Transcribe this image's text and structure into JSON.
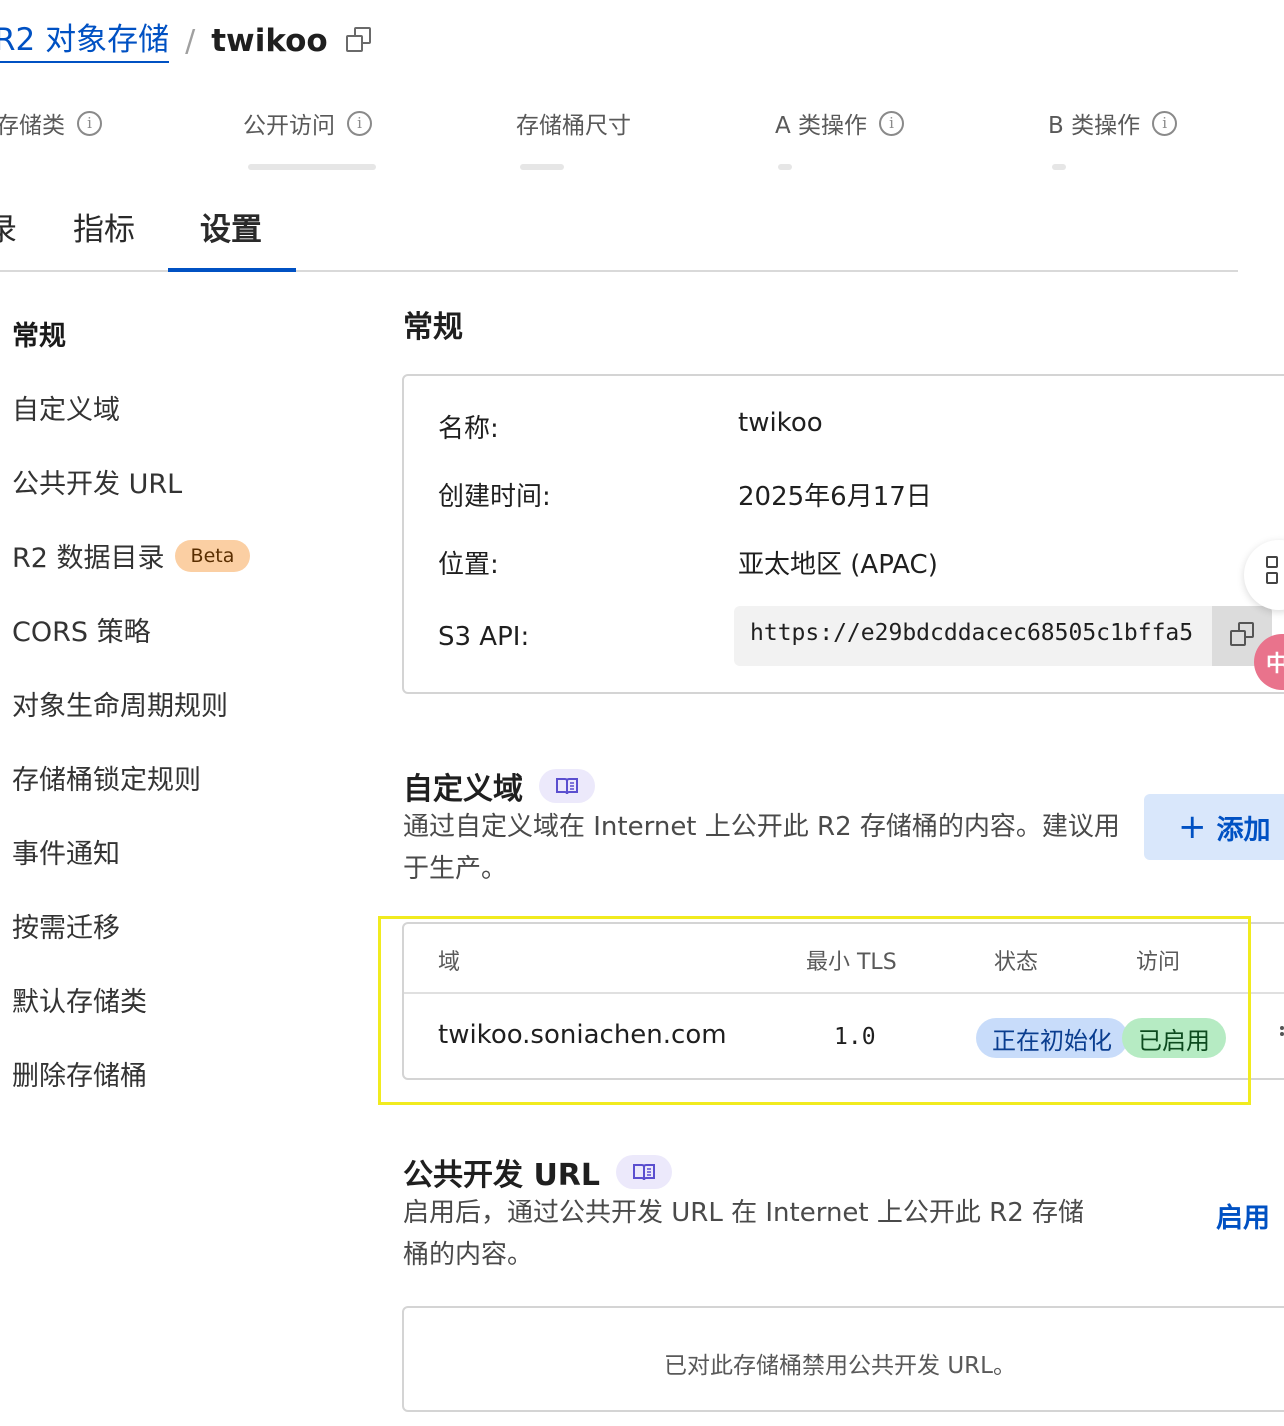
{
  "breadcrumb": {
    "parent": "R2 对象存储",
    "separator": "/",
    "current": "twikoo"
  },
  "stats": [
    {
      "label": "存储类"
    },
    {
      "label": "公开访问"
    },
    {
      "label": "存储桶尺寸"
    },
    {
      "label": "A 类操作"
    },
    {
      "label": "B 类操作"
    }
  ],
  "tabs": [
    {
      "label": "录"
    },
    {
      "label": "指标"
    },
    {
      "label": "设置",
      "active": true
    }
  ],
  "sidebar": {
    "items": [
      {
        "label": "常规",
        "active": true
      },
      {
        "label": "自定义域"
      },
      {
        "label": "公共开发 URL"
      },
      {
        "label": "R2 数据目录",
        "badge": "Beta"
      },
      {
        "label": "CORS 策略"
      },
      {
        "label": "对象生命周期规则"
      },
      {
        "label": "存储桶锁定规则"
      },
      {
        "label": "事件通知"
      },
      {
        "label": "按需迁移"
      },
      {
        "label": "默认存储类"
      },
      {
        "label": "删除存储桶"
      }
    ]
  },
  "general": {
    "title": "常规",
    "name_label": "名称:",
    "name_value": "twikoo",
    "created_label": "创建时间:",
    "created_value": "2025年6月17日",
    "location_label": "位置:",
    "location_value": "亚太地区 (APAC)",
    "api_label": "S3 API:",
    "api_value": "https://e29bdcddacec68505c1bffa5"
  },
  "custom_domain": {
    "title": "自定义域",
    "description": "通过自定义域在 Internet 上公开此 R2 存储桶的内容。建议用于生产。",
    "add_label": "添加",
    "columns": [
      "域",
      "最小 TLS",
      "状态",
      "访问"
    ],
    "rows": [
      {
        "domain": "twikoo.soniachen.com",
        "min_tls": "1.0",
        "status": "正在初始化",
        "access": "已启用"
      }
    ]
  },
  "dev_url": {
    "title": "公共开发 URL",
    "description": "启用后，通过公共开发 URL 在 Internet 上公开此 R2 存储桶的内容。",
    "enable_label": "启用",
    "disabled_message": "已对此存储桶禁用公共开发 URL。"
  },
  "widgets": {
    "ime_label": "中"
  },
  "colors": {
    "accent": "#0051c3",
    "highlight": "#f1eb1f",
    "status_initializing": "#c8dcfa",
    "status_enabled": "#b6ebc3",
    "beta_badge": "#fbcfa3"
  }
}
